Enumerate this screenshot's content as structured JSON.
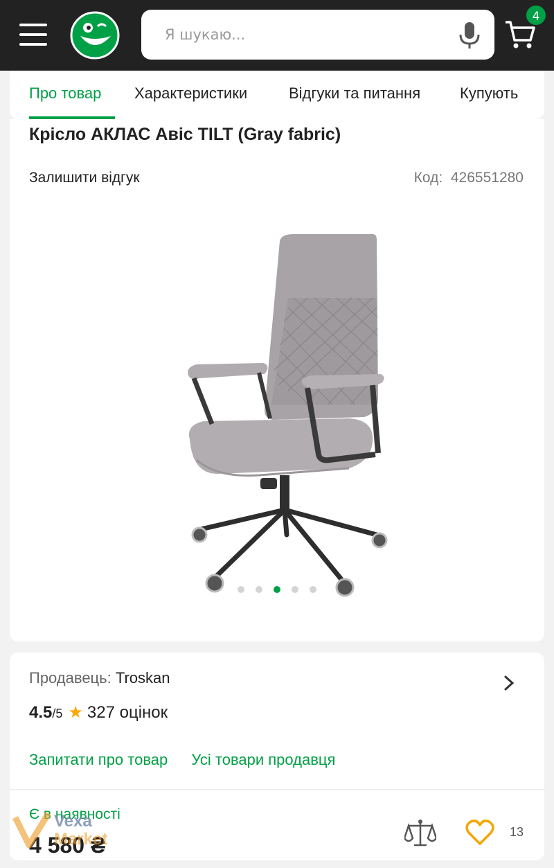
{
  "header": {
    "search_placeholder": "Я шукаю...",
    "cart_count": "4",
    "accent_color": "#00a046"
  },
  "tabs": [
    {
      "label": "Про товар",
      "active": true
    },
    {
      "label": "Характеристики",
      "active": false
    },
    {
      "label": "Відгуки та питання",
      "active": false
    },
    {
      "label": "Купують",
      "active": false
    }
  ],
  "product": {
    "title": "Крісло АКЛАС Авіс TILT (Gray fabric)",
    "review_link": "Залишити відгук",
    "code_label": "Код:",
    "code_value": "426551280",
    "gallery": {
      "total": 5,
      "active_index": 2
    }
  },
  "seller": {
    "label": "Продавець:",
    "name": "Troskan",
    "rating": "4.5",
    "rating_of": "/5",
    "ratings_count": "327 оцінок",
    "ask_link": "Запитати про товар",
    "all_goods_link": "Усі товари продавця"
  },
  "purchase": {
    "stock_status": "Є в наявності",
    "price": "4 580 ₴",
    "favorites_count": "13"
  },
  "watermark": {
    "line1": "Vexa",
    "line2": "Market"
  }
}
